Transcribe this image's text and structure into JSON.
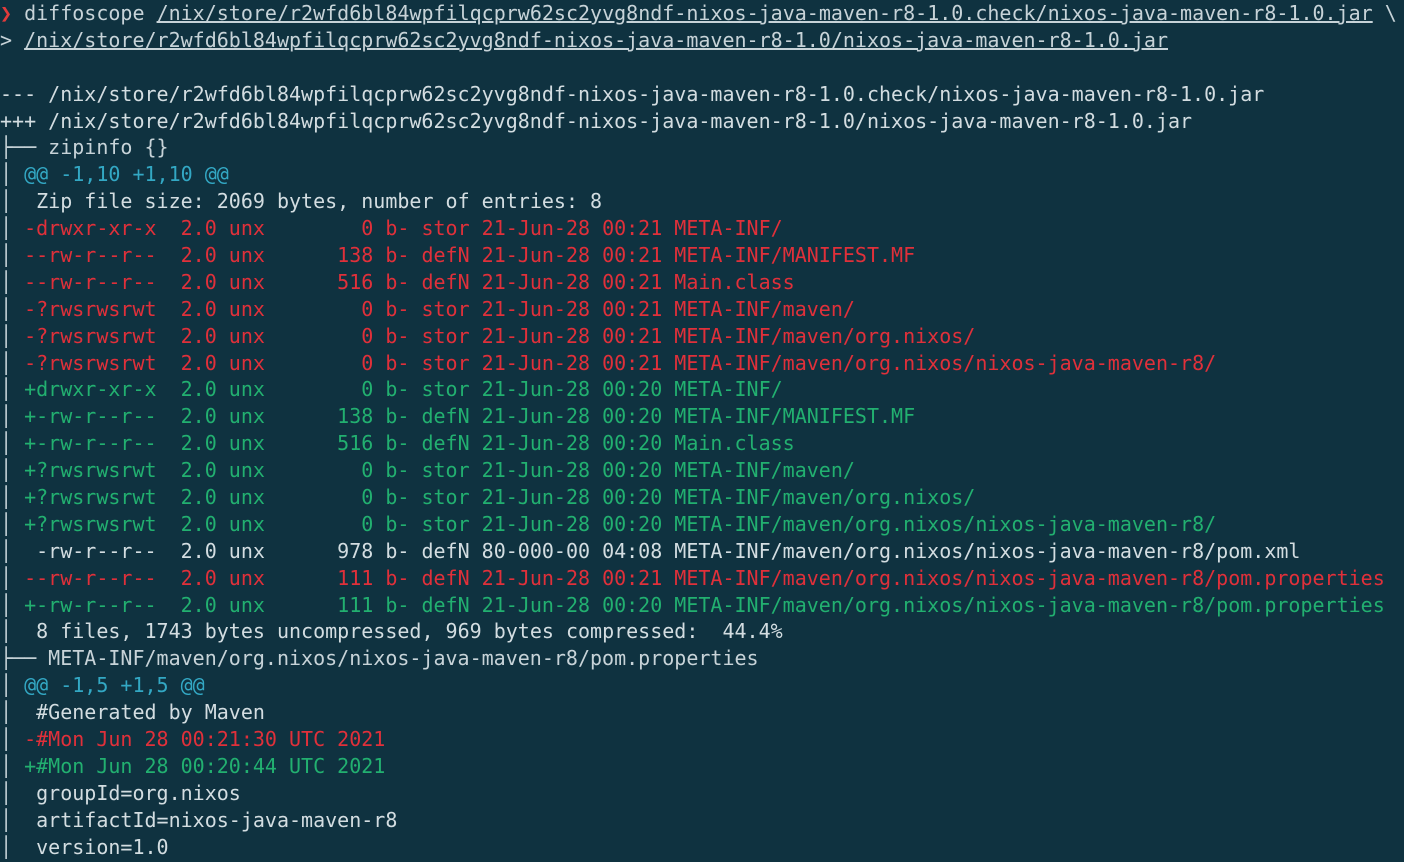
{
  "terminal": {
    "prompt_symbol": "❯",
    "command": "diffoscope",
    "arg1": "/nix/store/r2wfd6bl84wpfilqcprw62sc2yvg8ndf-nixos-java-maven-r8-1.0.check/nixos-java-maven-r8-1.0.jar",
    "continuation": " \\",
    "cont_prompt": ">",
    "arg2": "/nix/store/r2wfd6bl84wpfilqcprw62sc2yvg8ndf-nixos-java-maven-r8-1.0/nixos-java-maven-r8-1.0.jar",
    "lines": [
      {
        "kind": "plain",
        "text": ""
      },
      {
        "kind": "plain",
        "text": "--- /nix/store/r2wfd6bl84wpfilqcprw62sc2yvg8ndf-nixos-java-maven-r8-1.0.check/nixos-java-maven-r8-1.0.jar"
      },
      {
        "kind": "plain",
        "text": "+++ /nix/store/r2wfd6bl84wpfilqcprw62sc2yvg8ndf-nixos-java-maven-r8-1.0/nixos-java-maven-r8-1.0.jar"
      },
      {
        "kind": "tree",
        "text": "├── zipinfo {}"
      },
      {
        "kind": "hunk",
        "prefix": "│ ",
        "text": "@@ -1,10 +1,10 @@"
      },
      {
        "kind": "plain",
        "prefix": "│ ",
        "text": " Zip file size: 2069 bytes, number of entries: 8"
      },
      {
        "kind": "removed",
        "prefix": "│ ",
        "text": "-drwxr-xr-x  2.0 unx        0 b- stor 21-Jun-28 00:21 META-INF/"
      },
      {
        "kind": "removed",
        "prefix": "│ ",
        "text": "--rw-r--r--  2.0 unx      138 b- defN 21-Jun-28 00:21 META-INF/MANIFEST.MF"
      },
      {
        "kind": "removed",
        "prefix": "│ ",
        "text": "--rw-r--r--  2.0 unx      516 b- defN 21-Jun-28 00:21 Main.class"
      },
      {
        "kind": "removed",
        "prefix": "│ ",
        "text": "-?rwsrwsrwt  2.0 unx        0 b- stor 21-Jun-28 00:21 META-INF/maven/"
      },
      {
        "kind": "removed",
        "prefix": "│ ",
        "text": "-?rwsrwsrwt  2.0 unx        0 b- stor 21-Jun-28 00:21 META-INF/maven/org.nixos/"
      },
      {
        "kind": "removed",
        "prefix": "│ ",
        "text": "-?rwsrwsrwt  2.0 unx        0 b- stor 21-Jun-28 00:21 META-INF/maven/org.nixos/nixos-java-maven-r8/"
      },
      {
        "kind": "added",
        "prefix": "│ ",
        "text": "+drwxr-xr-x  2.0 unx        0 b- stor 21-Jun-28 00:20 META-INF/"
      },
      {
        "kind": "added",
        "prefix": "│ ",
        "text": "+-rw-r--r--  2.0 unx      138 b- defN 21-Jun-28 00:20 META-INF/MANIFEST.MF"
      },
      {
        "kind": "added",
        "prefix": "│ ",
        "text": "+-rw-r--r--  2.0 unx      516 b- defN 21-Jun-28 00:20 Main.class"
      },
      {
        "kind": "added",
        "prefix": "│ ",
        "text": "+?rwsrwsrwt  2.0 unx        0 b- stor 21-Jun-28 00:20 META-INF/maven/"
      },
      {
        "kind": "added",
        "prefix": "│ ",
        "text": "+?rwsrwsrwt  2.0 unx        0 b- stor 21-Jun-28 00:20 META-INF/maven/org.nixos/"
      },
      {
        "kind": "added",
        "prefix": "│ ",
        "text": "+?rwsrwsrwt  2.0 unx        0 b- stor 21-Jun-28 00:20 META-INF/maven/org.nixos/nixos-java-maven-r8/"
      },
      {
        "kind": "plain",
        "prefix": "│ ",
        "text": " -rw-r--r--  2.0 unx      978 b- defN 80-000-00 04:08 META-INF/maven/org.nixos/nixos-java-maven-r8/pom.xml"
      },
      {
        "kind": "removed",
        "prefix": "│ ",
        "text": "--rw-r--r--  2.0 unx      111 b- defN 21-Jun-28 00:21 META-INF/maven/org.nixos/nixos-java-maven-r8/pom.properties"
      },
      {
        "kind": "added",
        "prefix": "│ ",
        "text": "+-rw-r--r--  2.0 unx      111 b- defN 21-Jun-28 00:20 META-INF/maven/org.nixos/nixos-java-maven-r8/pom.properties"
      },
      {
        "kind": "plain",
        "prefix": "│ ",
        "text": " 8 files, 1743 bytes uncompressed, 969 bytes compressed:  44.4%"
      },
      {
        "kind": "tree",
        "text": "├── META-INF/maven/org.nixos/nixos-java-maven-r8/pom.properties"
      },
      {
        "kind": "hunk",
        "prefix": "│ ",
        "text": "@@ -1,5 +1,5 @@"
      },
      {
        "kind": "plain",
        "prefix": "│ ",
        "text": " #Generated by Maven"
      },
      {
        "kind": "removed",
        "prefix": "│ ",
        "text": "-#Mon Jun 28 00:21:30 UTC 2021"
      },
      {
        "kind": "added",
        "prefix": "│ ",
        "text": "+#Mon Jun 28 00:20:44 UTC 2021"
      },
      {
        "kind": "plain",
        "prefix": "│ ",
        "text": " groupId=org.nixos"
      },
      {
        "kind": "plain",
        "prefix": "│ ",
        "text": " artifactId=nixos-java-maven-r8"
      },
      {
        "kind": "plain",
        "prefix": "│ ",
        "text": " version=1.0"
      }
    ]
  },
  "colors": {
    "background": "#0f3240",
    "removed": "#e0303a",
    "added": "#22b070",
    "hunk": "#33a8c4",
    "text": "#d3dde1"
  }
}
